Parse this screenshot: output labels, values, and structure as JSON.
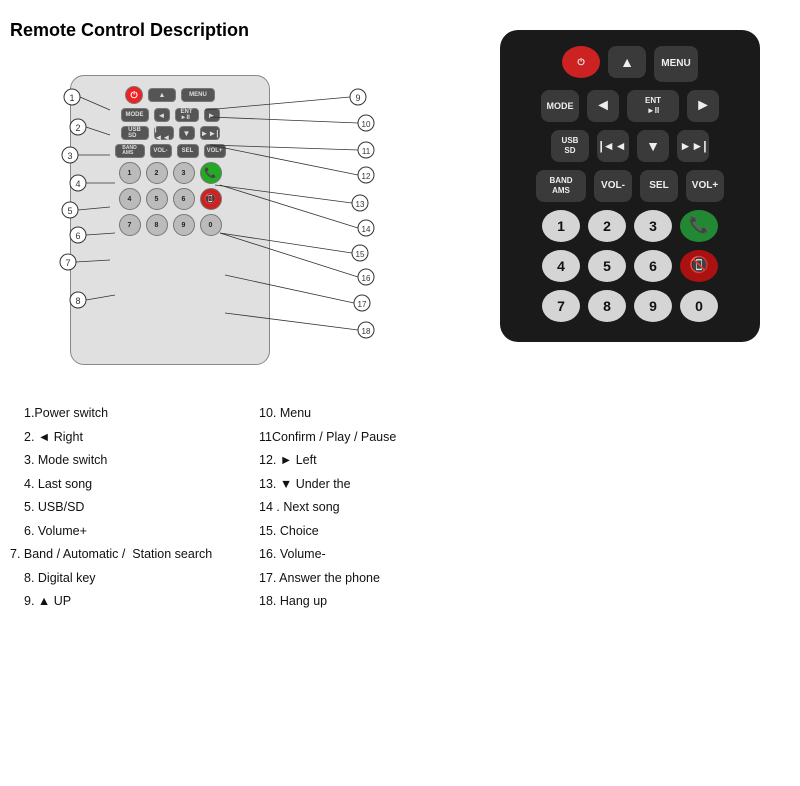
{
  "title": "Remote Control Description",
  "diagram": {
    "label": "Remote diagram"
  },
  "descriptions_left": [
    {
      "num": "1",
      "text": "1.Power switch"
    },
    {
      "num": "2",
      "text": "2. ◄ Right"
    },
    {
      "num": "3",
      "text": "3. Mode switch"
    },
    {
      "num": "4",
      "text": "4. Last song"
    },
    {
      "num": "5",
      "text": "5. USB/SD"
    },
    {
      "num": "6",
      "text": "6. Volume+"
    },
    {
      "num": "7",
      "text": "7. Band / Automatic /  Station search"
    },
    {
      "num": "8",
      "text": "8. Digital key"
    },
    {
      "num": "9",
      "text": "9. ▲ UP"
    }
  ],
  "descriptions_right": [
    {
      "num": "10",
      "text": "10. Menu"
    },
    {
      "num": "11",
      "text": "11Confirm / Play / Pause"
    },
    {
      "num": "12",
      "text": "12. ► Left"
    },
    {
      "num": "13",
      "text": "13. ▼ Under the"
    },
    {
      "num": "14",
      "text": "14 . Next song"
    },
    {
      "num": "15",
      "text": "15. Choice"
    },
    {
      "num": "16",
      "text": "16. Volume-"
    },
    {
      "num": "17",
      "text": "17. Answer the phone"
    },
    {
      "num": "18",
      "text": "18. Hang up"
    }
  ],
  "remote_buttons": {
    "row1": [
      "POWER",
      "▲",
      "MENU"
    ],
    "row2": [
      "MODE",
      "◄",
      "ENT ►II"
    ],
    "row3": [
      "USB SD",
      "I◄◄",
      "▼",
      "►I"
    ],
    "row4": [
      "BAND AMS",
      "VOL-",
      "SEL",
      "VOL+"
    ],
    "row5": [
      "1",
      "2",
      "3",
      "CALL"
    ],
    "row6": [
      "4",
      "5",
      "6",
      "END"
    ],
    "row7": [
      "7",
      "8",
      "9",
      "0"
    ]
  }
}
